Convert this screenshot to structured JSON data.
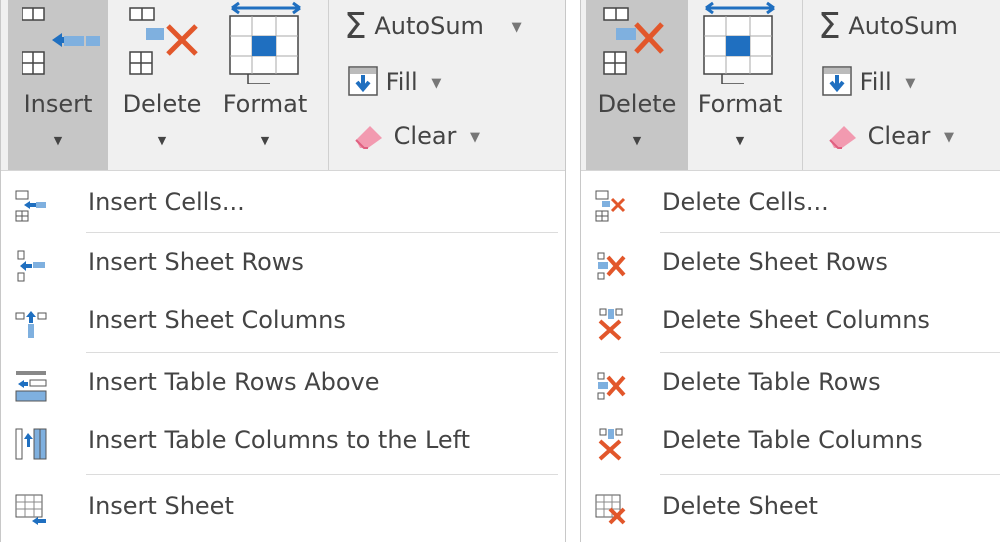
{
  "insert_panel": {
    "ribbon": {
      "insert_label": "Insert",
      "delete_label": "Delete",
      "format_label": "Format",
      "autosum_label": "AutoSum",
      "fill_label": "Fill",
      "clear_label": "Clear"
    },
    "menu": [
      {
        "label": "Insert Cells...",
        "icon": "insert-cells-icon"
      },
      {
        "label": "Insert Sheet Rows",
        "icon": "insert-sheet-rows-icon"
      },
      {
        "label": "Insert Sheet Columns",
        "icon": "insert-sheet-columns-icon"
      },
      {
        "label": "Insert Table Rows Above",
        "icon": "insert-table-rows-above-icon"
      },
      {
        "label": "Insert Table Columns to the Left",
        "icon": "insert-table-columns-left-icon"
      },
      {
        "label": "Insert Sheet",
        "icon": "insert-sheet-icon"
      }
    ]
  },
  "delete_panel": {
    "ribbon": {
      "delete_label": "Delete",
      "format_label": "Format",
      "autosum_label": "AutoSum",
      "fill_label": "Fill",
      "clear_label": "Clear"
    },
    "menu": [
      {
        "label": "Delete Cells...",
        "icon": "delete-cells-icon"
      },
      {
        "label": "Delete Sheet Rows",
        "icon": "delete-sheet-rows-icon"
      },
      {
        "label": "Delete Sheet Columns",
        "icon": "delete-sheet-columns-icon"
      },
      {
        "label": "Delete Table Rows",
        "icon": "delete-table-rows-icon"
      },
      {
        "label": "Delete Table Columns",
        "icon": "delete-table-columns-icon"
      },
      {
        "label": "Delete Sheet",
        "icon": "delete-sheet-icon"
      }
    ]
  },
  "colors": {
    "accent_blue": "#1f6fc0",
    "delete_red": "#e2572b",
    "ribbon_bg": "#f0f0f0",
    "active_bg": "#c6c6c6"
  }
}
